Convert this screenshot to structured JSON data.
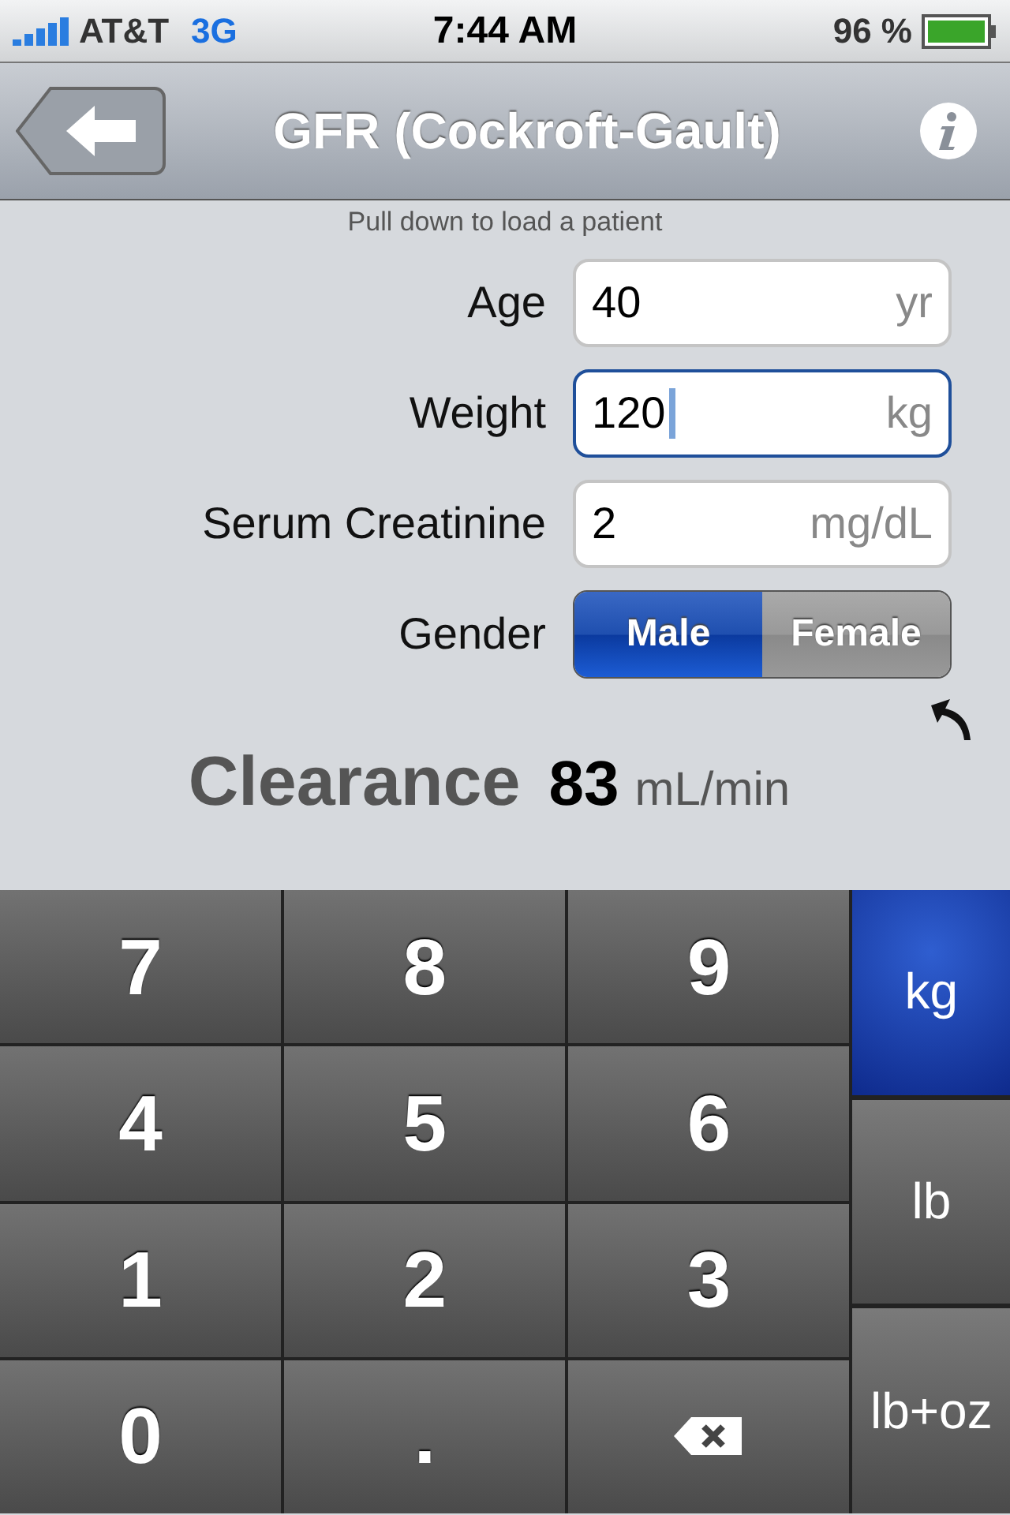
{
  "status_bar": {
    "carrier": "AT&T",
    "network": "3G",
    "time": "7:44 AM",
    "battery": "96 %"
  },
  "nav_bar": {
    "title": "GFR (Cockroft-Gault)"
  },
  "hint": "Pull down to load a patient",
  "fields": [
    {
      "label": "Age",
      "value": "40",
      "unit": "yr",
      "focused": false
    },
    {
      "label": "Weight",
      "value": "120",
      "unit": "kg",
      "focused": true
    },
    {
      "label": "Serum Creatinine",
      "value": "2",
      "unit": "mg/dL",
      "focused": false
    }
  ],
  "gender": {
    "label": "Gender",
    "options": [
      {
        "label": "Male",
        "selected": true
      },
      {
        "label": "Female",
        "selected": false
      }
    ]
  },
  "result": {
    "label": "Clearance",
    "value": "83",
    "unit": "mL/min"
  },
  "keypad": {
    "keys": [
      {
        "kind": "digit",
        "label": "7"
      },
      {
        "kind": "digit",
        "label": "8"
      },
      {
        "kind": "digit",
        "label": "9"
      },
      {
        "kind": "digit",
        "label": "4"
      },
      {
        "kind": "digit",
        "label": "5"
      },
      {
        "kind": "digit",
        "label": "6"
      },
      {
        "kind": "digit",
        "label": "1"
      },
      {
        "kind": "digit",
        "label": "2"
      },
      {
        "kind": "digit",
        "label": "3"
      },
      {
        "kind": "digit",
        "label": "0"
      },
      {
        "kind": "digit",
        "label": "."
      },
      {
        "kind": "backspace"
      }
    ],
    "units": [
      {
        "label": "kg",
        "selected": true
      },
      {
        "label": "lb",
        "selected": false
      },
      {
        "label": "lb+oz",
        "selected": false
      }
    ]
  }
}
